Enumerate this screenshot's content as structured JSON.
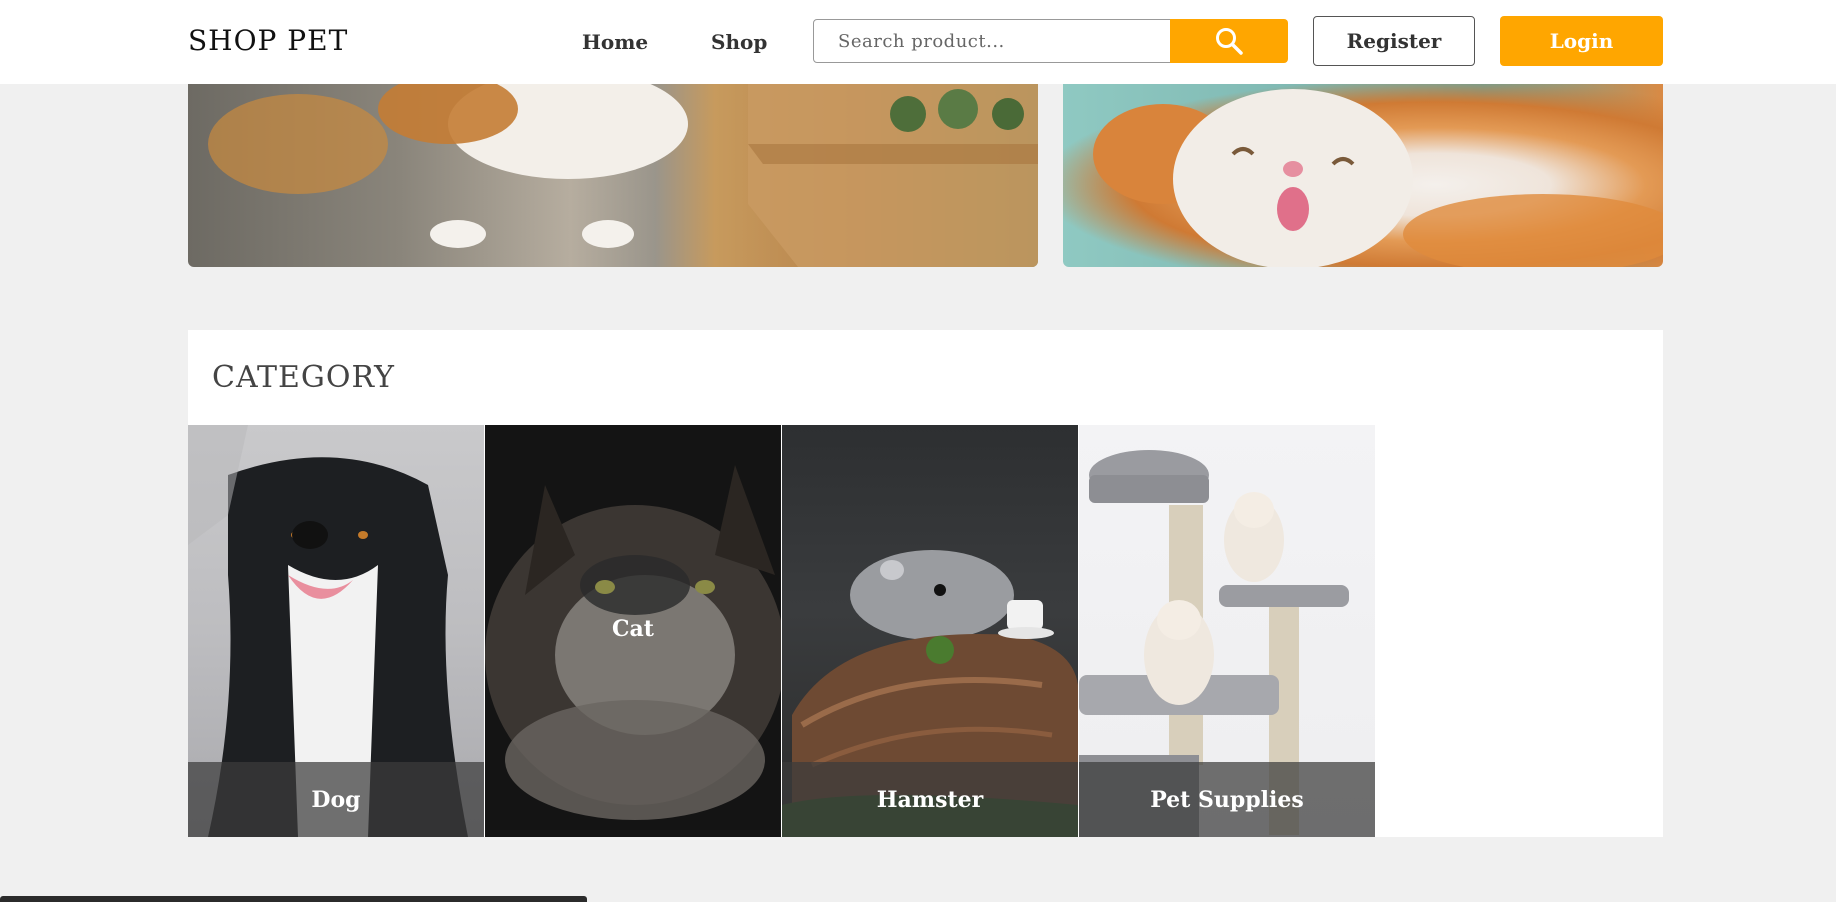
{
  "header": {
    "logo": "SHOP PET",
    "nav": {
      "home": "Home",
      "shop": "Shop"
    },
    "search": {
      "placeholder": "Search product...",
      "icon": "search-icon"
    },
    "register_label": "Register",
    "login_label": "Login"
  },
  "category": {
    "title": "CATEGORY",
    "items": [
      {
        "label": "Dog"
      },
      {
        "label": "Cat"
      },
      {
        "label": "Hamster"
      },
      {
        "label": "Pet Supplies"
      }
    ]
  },
  "colors": {
    "accent": "#ffa600",
    "background": "#f0f0f0",
    "card_overlay": "#3c3c3c"
  }
}
